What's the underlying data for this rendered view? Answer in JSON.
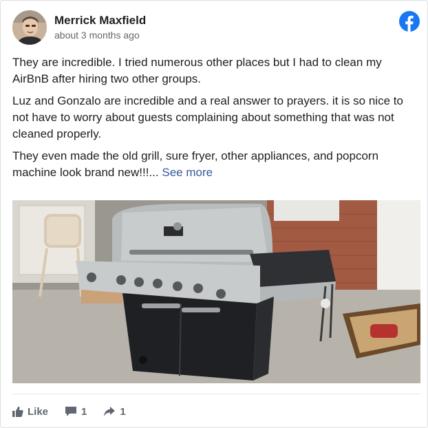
{
  "post": {
    "author": "Merrick Maxfield",
    "time": "about 3 months ago",
    "paragraphs": [
      "They are incredible. I tried numerous other places but I had to clean my AirBnB after hiring two other groups.",
      "Luz and Gonzalo are incredible and a real answer to prayers. it is so nice to not have to worry about guests complaining about something that was not cleaned properly."
    ],
    "last_paragraph": "They even made the old grill, sure fryer, other appliances, and popcorn machine look brand new!!!...",
    "see_more": "See more"
  },
  "actions": {
    "like_label": "Like",
    "comment_count": "1",
    "share_count": "1"
  },
  "icons": {
    "logo": "facebook-icon",
    "like": "thumbs-up-icon",
    "comment": "comment-bubble-icon",
    "share": "share-arrow-icon"
  },
  "colors": {
    "brand": "#1877f2",
    "link": "#385898",
    "muted": "#65676b",
    "action": "#606770"
  }
}
